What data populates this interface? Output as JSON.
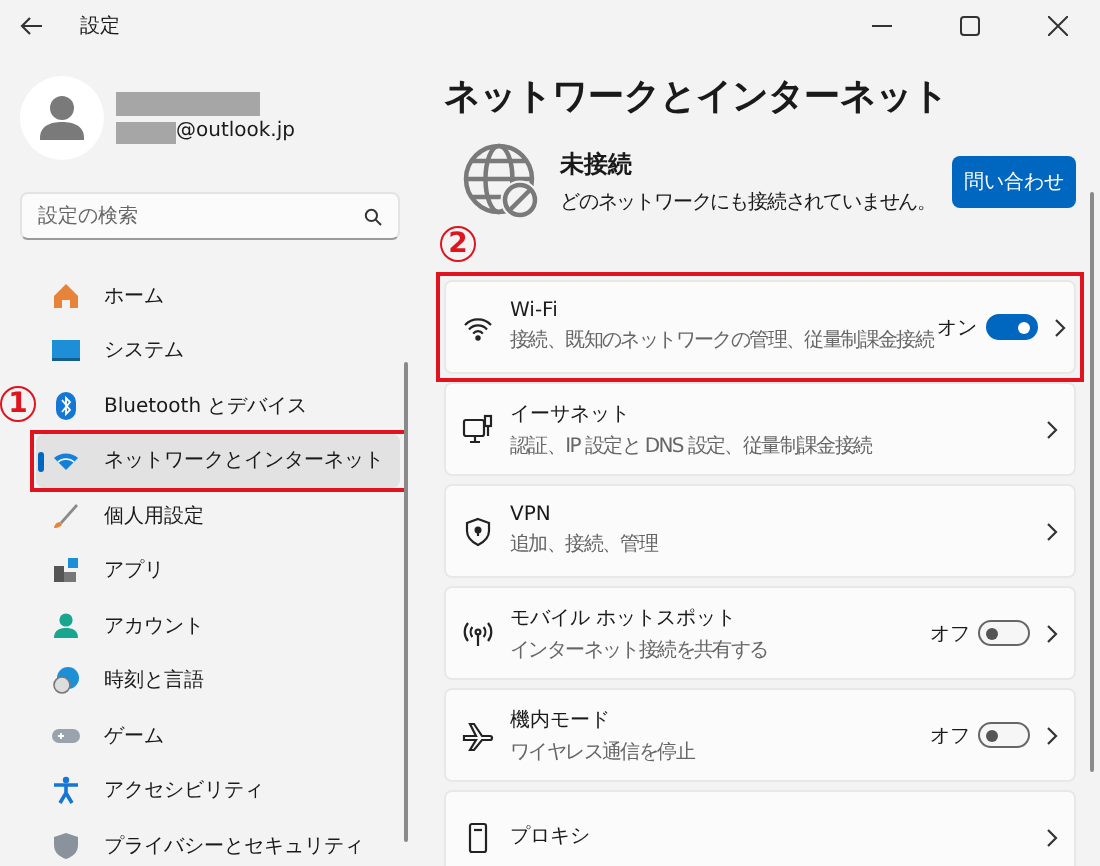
{
  "window": {
    "title": "設定"
  },
  "profile": {
    "email": "@outlook.jp"
  },
  "search": {
    "placeholder": "設定の検索"
  },
  "sidebar": {
    "items": [
      {
        "label": "ホーム",
        "selected": false
      },
      {
        "label": "システム",
        "selected": false
      },
      {
        "label": "Bluetooth とデバイス",
        "selected": false,
        "annotation": "1"
      },
      {
        "label": "ネットワークとインターネット",
        "selected": true,
        "highlighted": true
      },
      {
        "label": "個人用設定",
        "selected": false
      },
      {
        "label": "アプリ",
        "selected": false
      },
      {
        "label": "アカウント",
        "selected": false
      },
      {
        "label": "時刻と言語",
        "selected": false
      },
      {
        "label": "ゲーム",
        "selected": false
      },
      {
        "label": "アクセシビリティ",
        "selected": false
      },
      {
        "label": "プライバシーとセキュリティ",
        "selected": false
      }
    ]
  },
  "main": {
    "title": "ネットワークとインターネット",
    "status": {
      "title": "未接続",
      "description": "どのネットワークにも接続されていません。",
      "button": "問い合わせ"
    },
    "cards": [
      {
        "kind": "toggle",
        "title": "Wi-Fi",
        "subtitle": "接続、既知のネットワークの管理、従量制課金接続",
        "state_label": "オン",
        "on": true,
        "highlighted": true,
        "annotation": "2"
      },
      {
        "kind": "link",
        "title": "イーサネット",
        "subtitle": "認証、IP 設定と DNS 設定、従量制課金接続"
      },
      {
        "kind": "link",
        "title": "VPN",
        "subtitle": "追加、接続、管理"
      },
      {
        "kind": "toggle",
        "title": "モバイル ホットスポット",
        "subtitle": "インターネット接続を共有する",
        "state_label": "オフ",
        "on": false
      },
      {
        "kind": "toggle",
        "title": "機内モード",
        "subtitle": "ワイヤレス通信を停止",
        "state_label": "オフ",
        "on": false
      },
      {
        "kind": "link",
        "title": "プロキシ"
      }
    ]
  }
}
